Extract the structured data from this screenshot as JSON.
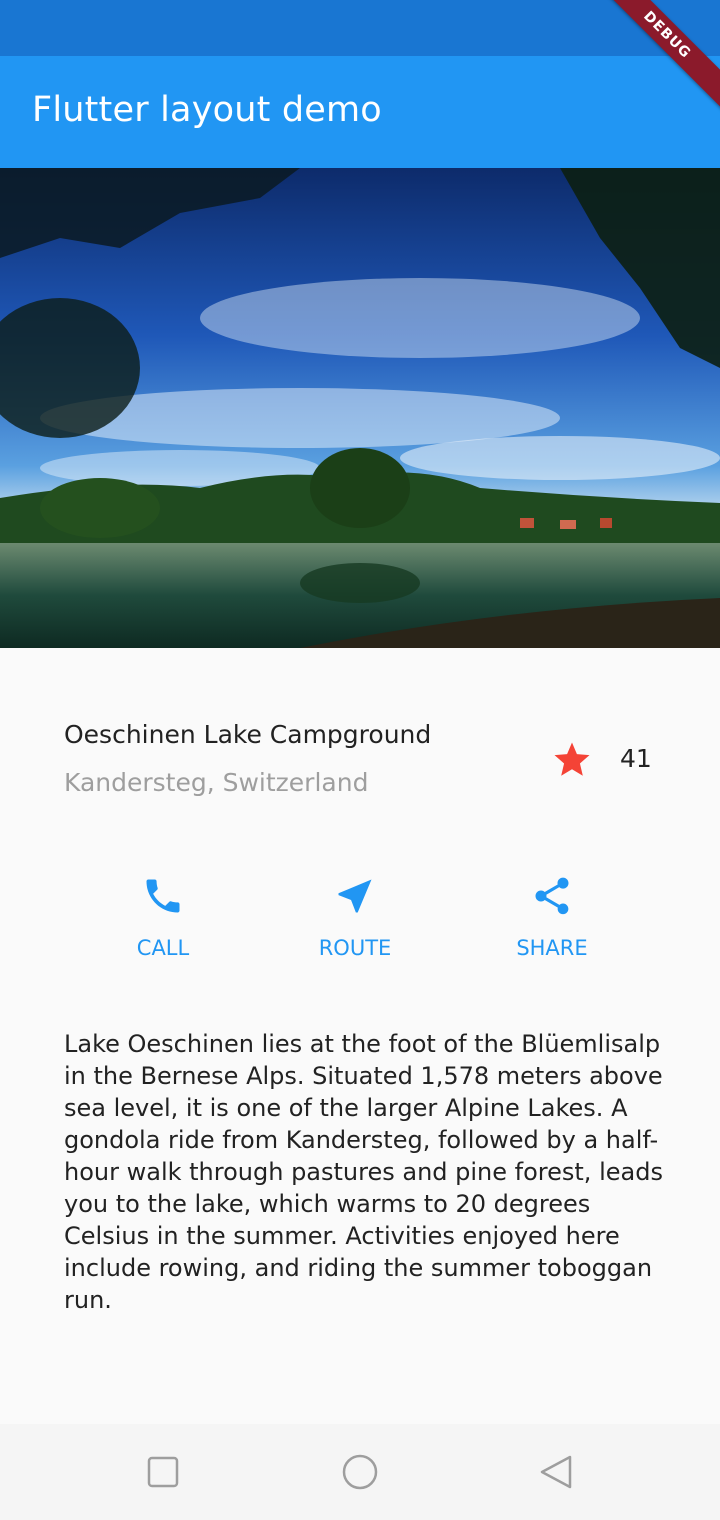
{
  "app_bar": {
    "title": "Flutter layout demo"
  },
  "debug_banner": {
    "label": "DEBUG"
  },
  "place": {
    "name": "Oeschinen Lake Campground",
    "location": "Kandersteg, Switzerland",
    "favorite_count": "41"
  },
  "actions": [
    {
      "label": "CALL",
      "icon": "phone-icon"
    },
    {
      "label": "ROUTE",
      "icon": "navigation-arrow-icon"
    },
    {
      "label": "SHARE",
      "icon": "share-icon"
    }
  ],
  "description": "Lake Oeschinen lies at the foot of the Blüemlisalp in the Bernese Alps. Situated 1,578 meters above sea level, it is one of the larger Alpine Lakes. A gondola ride from Kandersteg, followed by a half-hour walk through pastures and pine forest, leads you to the lake, which warms to 20 degrees Celsius in the summer. Activities enjoyed here include rowing, and riding the summer toboggan run.",
  "colors": {
    "primary": "#2196f3",
    "primary_dark": "#1976d2",
    "star": "#f44336",
    "debug_banner": "#8b1a2b"
  },
  "nav_bar": {
    "buttons": [
      "recent-apps-icon",
      "home-icon",
      "back-icon"
    ]
  }
}
